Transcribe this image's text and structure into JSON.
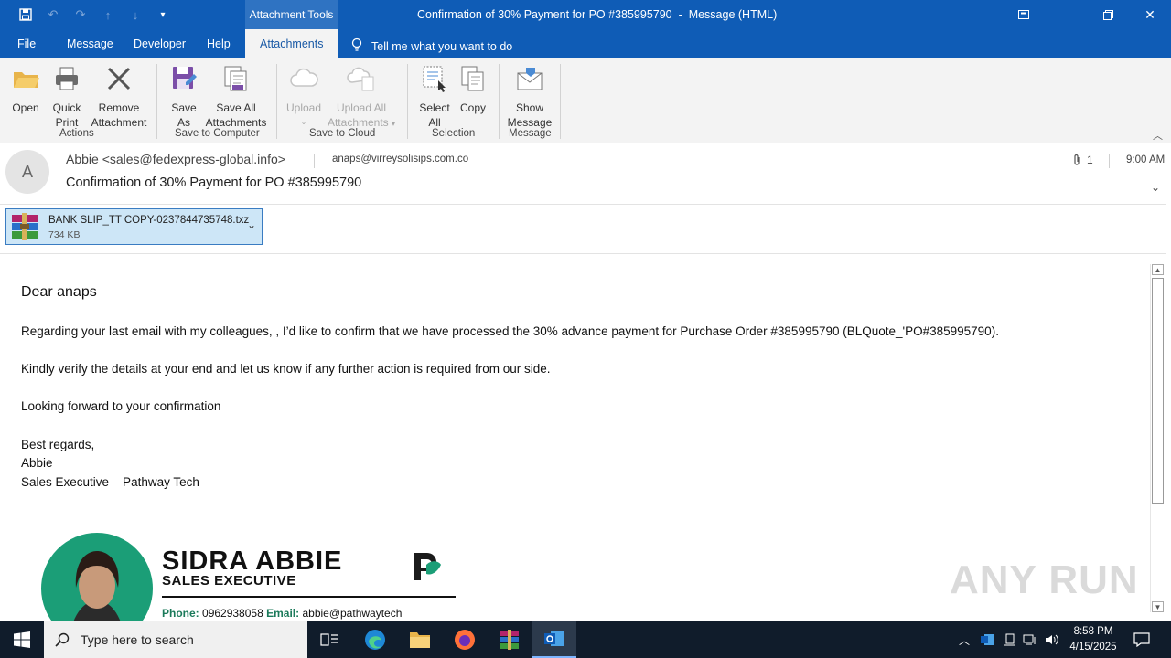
{
  "window": {
    "context_tab_group": "Attachment Tools",
    "title": "Confirmation of 30% Payment for PO #385995790  -  Message (HTML)"
  },
  "tabs": [
    "File",
    "Message",
    "Developer",
    "Help",
    "Attachments"
  ],
  "active_tab": "Attachments",
  "tell_me": "Tell me what you want to do",
  "ribbon": {
    "actions": {
      "open": "Open",
      "quick_print_1": "Quick",
      "quick_print_2": "Print",
      "remove_1": "Remove",
      "remove_2": "Attachment",
      "group": "Actions"
    },
    "save_to_computer": {
      "save_as_1": "Save",
      "save_as_2": "As",
      "save_all_1": "Save All",
      "save_all_2": "Attachments",
      "group": "Save to Computer"
    },
    "save_to_cloud": {
      "upload": "Upload",
      "upload_all_1": "Upload All",
      "upload_all_2": "Attachments",
      "group": "Save to Cloud"
    },
    "selection": {
      "select_all_1": "Select",
      "select_all_2": "All",
      "copy": "Copy",
      "group": "Selection"
    },
    "message": {
      "show_1": "Show",
      "show_2": "Message",
      "group": "Message"
    }
  },
  "header": {
    "avatar_initial": "A",
    "from": "Abbie <sales@fedexpress-global.info>",
    "to": "anaps@virreysolisips.com.co",
    "subject": "Confirmation of 30% Payment for PO #385995790",
    "attachment_count": "1",
    "time": "9:00 AM"
  },
  "attachment": {
    "name": "BANK SLIP_TT COPY-0237844735748.txz",
    "size": "734 KB"
  },
  "body": {
    "greeting": "Dear anaps",
    "para1": "Regarding your last email with my colleagues, , I’d like to confirm that we have processed the 30% advance payment for Purchase Order #385995790 (BLQuote_'PO#385995790).",
    "para2": "Kindly verify the details at your end and let us know if any further action is required from our side.",
    "para3": "Looking forward to your confirmation",
    "closing": "Best regards,",
    "sender": "Abbie",
    "sender_title": "Sales Executive – Pathway Tech"
  },
  "signature": {
    "name": "SIDRA ABBIE",
    "role": "SALES EXECUTIVE",
    "phone_label": "Phone:",
    "phone": "0962938058",
    "email_label": "Email:",
    "email": "abbie@pathwaytech"
  },
  "watermark": "ANY RUN",
  "taskbar": {
    "search_placeholder": "Type here to search",
    "time": "8:58 PM",
    "date": "4/15/2025"
  }
}
